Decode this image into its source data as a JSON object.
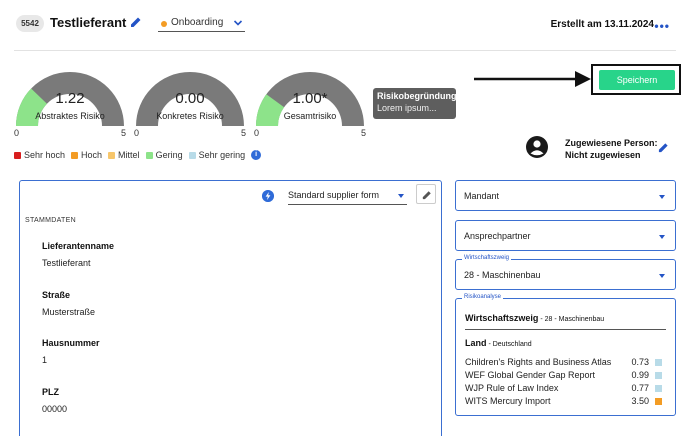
{
  "header": {
    "id": "5542",
    "title": "Testlieferant",
    "status": "Onboarding",
    "created": "Erstellt am 13.11.2024",
    "more": "•••"
  },
  "colors": {
    "primary": "#2454c6",
    "save": "#28d48a",
    "gauge_track": "#7a7a7a",
    "gauge_fill": "#8de38a",
    "onboarding_dot": "#f39c24"
  },
  "gauges": [
    {
      "value": "1.22",
      "label": "Abstraktes Risiko",
      "min": "0",
      "max": "5",
      "fraction": 0.244
    },
    {
      "value": "0.00",
      "label": "Konkretes Risiko",
      "min": "0",
      "max": "5",
      "fraction": 0.0
    },
    {
      "value": "1.00*",
      "label": "Gesamtrisiko",
      "min": "0",
      "max": "5",
      "fraction": 0.2
    }
  ],
  "risk_reason": {
    "title": "Risikobegründung",
    "text": "Lorem ipsum..."
  },
  "save_label": "Speichern",
  "legend": [
    {
      "label": "Sehr hoch",
      "color": "#d81e1e"
    },
    {
      "label": "Hoch",
      "color": "#f39c24"
    },
    {
      "label": "Mittel",
      "color": "#f7c66b"
    },
    {
      "label": "Gering",
      "color": "#8de38a"
    },
    {
      "label": "Sehr gering",
      "color": "#b8dbe8"
    }
  ],
  "assigned": {
    "label": "Zugewiesene Person:",
    "value": "Nicht zugewiesen"
  },
  "form": {
    "selector": "Standard supplier form",
    "section": "STAMMDATEN",
    "fields": [
      {
        "label": "Lieferantenname",
        "value": "Testlieferant"
      },
      {
        "label": "Straße",
        "value": "Musterstraße"
      },
      {
        "label": "Hausnummer",
        "value": "1"
      },
      {
        "label": "PLZ",
        "value": "00000"
      }
    ]
  },
  "right": {
    "mandant": "Mandant",
    "ansprechpartner": "Ansprechpartner",
    "wirtschaftszweig_legend": "Wirtschaftszweig",
    "wirtschaftszweig_value": "28 - Maschinenbau",
    "risk_legend": "Risikoanalyse",
    "risk_heading_bold": "Wirtschaftszweig",
    "risk_heading_rest": " - 28 - Maschinenbau",
    "land_bold": "Land",
    "land_rest": " - Deutschland",
    "rows": [
      {
        "name": "Children's Rights and Business Atlas",
        "value": "0.73",
        "color": "#b8dbe8"
      },
      {
        "name": "WEF Global Gender Gap Report",
        "value": "0.99",
        "color": "#b8dbe8"
      },
      {
        "name": "WJP Rule of Law Index",
        "value": "0.77",
        "color": "#b8dbe8"
      },
      {
        "name": "WITS Mercury Import",
        "value": "3.50",
        "color": "#f39c24"
      }
    ]
  }
}
